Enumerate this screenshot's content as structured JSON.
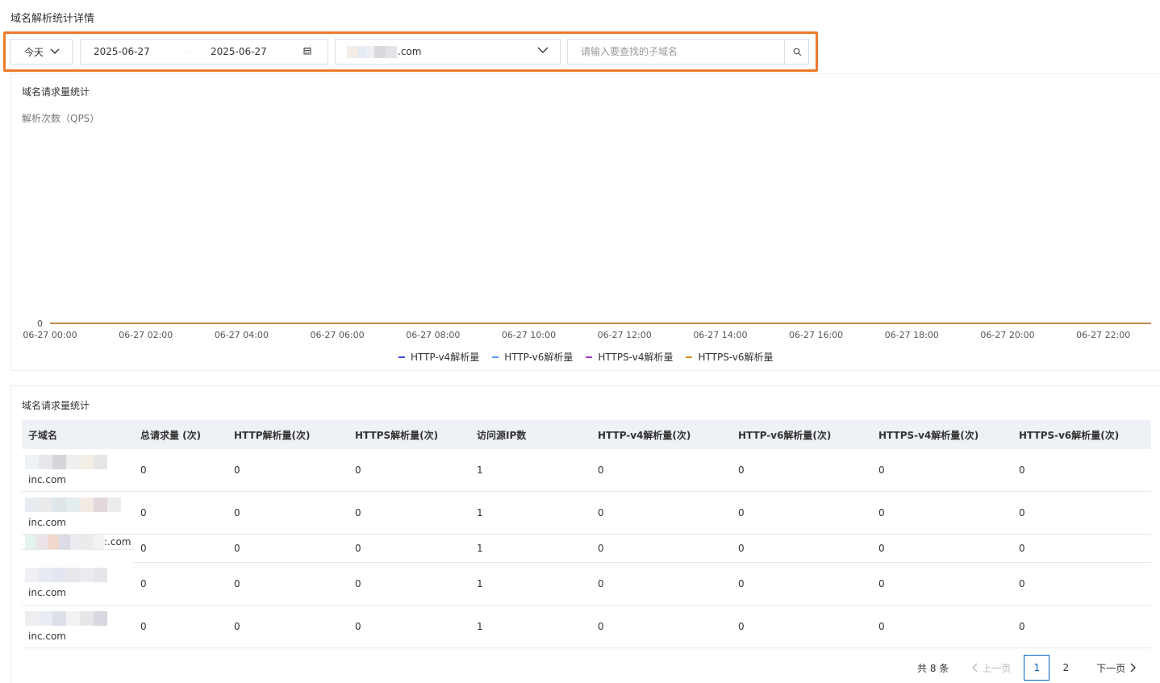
{
  "page": {
    "title": "域名解析统计详情"
  },
  "filters": {
    "period": "今天",
    "date_start": "2025-06-27",
    "date_separator": "-",
    "date_end": "2025-06-27",
    "domain_suffix": ".com",
    "search_placeholder": "请输入要查找的子域名"
  },
  "chart_section": {
    "title": "域名请求量统计",
    "ylabel": "解析次数（QPS）"
  },
  "chart_data": {
    "type": "line",
    "title": "域名请求量统计",
    "ylabel": "解析次数（QPS）",
    "xlabel": "",
    "x_ticks": [
      "06-27 00:00",
      "06-27 02:00",
      "06-27 04:00",
      "06-27 06:00",
      "06-27 08:00",
      "06-27 10:00",
      "06-27 12:00",
      "06-27 14:00",
      "06-27 16:00",
      "06-27 18:00",
      "06-27 20:00",
      "06-27 22:00"
    ],
    "y_ticks": [
      "0"
    ],
    "ylim": [
      0,
      0
    ],
    "grid": false,
    "legend_position": "bottom",
    "series": [
      {
        "name": "HTTP-v4解析量",
        "color": "#3b46d6",
        "values": [
          0,
          0,
          0,
          0,
          0,
          0,
          0,
          0,
          0,
          0,
          0,
          0
        ]
      },
      {
        "name": "HTTP-v6解析量",
        "color": "#5b9bf0",
        "values": [
          0,
          0,
          0,
          0,
          0,
          0,
          0,
          0,
          0,
          0,
          0,
          0
        ]
      },
      {
        "name": "HTTPS-v4解析量",
        "color": "#a03ad0",
        "values": [
          0,
          0,
          0,
          0,
          0,
          0,
          0,
          0,
          0,
          0,
          0,
          0
        ]
      },
      {
        "name": "HTTPS-v6解析量",
        "color": "#d8901a",
        "values": [
          0,
          0,
          0,
          0,
          0,
          0,
          0,
          0,
          0,
          0,
          0,
          0
        ]
      }
    ]
  },
  "table_section": {
    "title": "域名请求量统计",
    "columns": [
      "子域名",
      "总请求量 (次)",
      "HTTP解析量(次)",
      "HTTPS解析量(次)",
      "访问源IP数",
      "HTTP-v4解析量(次)",
      "HTTP-v6解析量(次)",
      "HTTPS-v4解析量(次)",
      "HTTPS-v6解析量(次)"
    ],
    "rows": [
      {
        "subdomain_suffix": "inc.com",
        "values": [
          "0",
          "0",
          "0",
          "1",
          "0",
          "0",
          "0",
          "0"
        ]
      },
      {
        "subdomain_suffix": "inc.com",
        "values": [
          "0",
          "0",
          "0",
          "1",
          "0",
          "0",
          "0",
          "0"
        ]
      },
      {
        "subdomain_suffix": ":.com",
        "values": [
          "0",
          "0",
          "0",
          "1",
          "0",
          "0",
          "0",
          "0"
        ]
      },
      {
        "subdomain_suffix": "inc.com",
        "values": [
          "0",
          "0",
          "0",
          "1",
          "0",
          "0",
          "0",
          "0"
        ]
      },
      {
        "subdomain_suffix": "inc.com",
        "values": [
          "0",
          "0",
          "0",
          "1",
          "0",
          "0",
          "0",
          "0"
        ]
      }
    ]
  },
  "pagination": {
    "total": "共 8 条",
    "prev": "上一页",
    "pages": [
      "1",
      "2"
    ],
    "current": "1",
    "next": "下一页"
  }
}
